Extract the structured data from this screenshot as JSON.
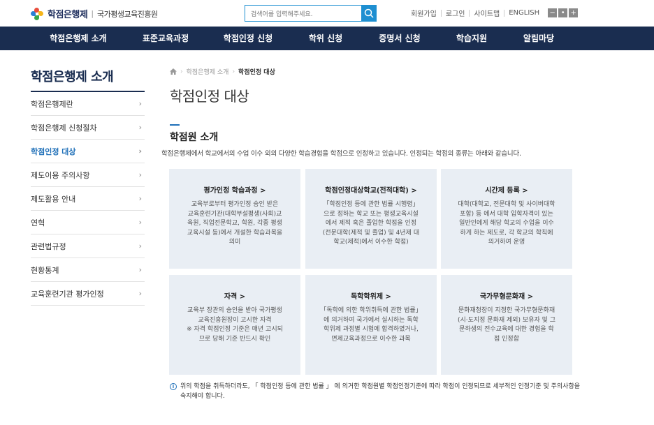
{
  "header": {
    "logo_main": "학점은행제",
    "logo_separator": "|",
    "logo_sub": "국가평생교육진흥원",
    "search_placeholder": "검색어를 입력해주세요.",
    "utils": [
      "회원가입",
      "로그인",
      "사이트맵",
      "ENGLISH"
    ],
    "zoom": [
      "−",
      "•",
      "+"
    ]
  },
  "gnb": [
    "학점은행제 소개",
    "표준교육과정",
    "학점인정 신청",
    "학위 신청",
    "증명서 신청",
    "학습지원",
    "알림마당"
  ],
  "sidebar": {
    "title": "학점은행제 소개",
    "items": [
      {
        "label": "학점은행제란",
        "active": false
      },
      {
        "label": "학점은행제 신청절차",
        "active": false
      },
      {
        "label": "학점인정 대상",
        "active": true
      },
      {
        "label": "제도이용 주의사항",
        "active": false
      },
      {
        "label": "제도활용 안내",
        "active": false
      },
      {
        "label": "연혁",
        "active": false
      },
      {
        "label": "관련법규정",
        "active": false
      },
      {
        "label": "현황통계",
        "active": false
      },
      {
        "label": "교육훈련기관 평가인정",
        "active": false
      }
    ]
  },
  "breadcrumb": [
    "학점은행제 소개",
    "학점인정 대상"
  ],
  "page_title": "학점인정 대상",
  "section": {
    "title": "학점원 소개",
    "desc": "학점은행제에서 학교에서의 수업 이수 외의 다양한 학습경험을 학점으로 인정하고 있습니다. 인정되는 학점의 종류는 아래와 같습니다."
  },
  "cards": [
    {
      "title": "평가인정 학습과정 >",
      "desc": "교육부로부터 평가인정 승인 받은\n교육훈련기관(대학부설평생(사회)교\n육원, 직업전문학교, 학원, 각종 평생\n교육시설 등)에서 개설한 학습과목을\n의미"
    },
    {
      "title": "학점인정대상학교(전적대학) >",
      "desc": "「학점인정 등에 관한 법률 시행령」\n으로 정하는 학교 또는 평생교육시설\n에서 제적 혹은 졸업한 학점을 인정\n(전문대학(제적 및 졸업) 및 4년제 대\n학교(제적)에서 이수한 학점)"
    },
    {
      "title": "시간제 등록 >",
      "desc": "대학(대학교, 전문대학 및 사이버대학\n포함) 등 에서 대학 입학자격이 있는\n일반인에게 해당 학교의 수업을 이수\n하게 하는 제도로, 각 학교의 학칙에\n의거하여 운영"
    },
    {
      "title": "자격 >",
      "desc": "교육부 장관의 승인을 받아 국가평생\n교육진흥원장이 고시한 자격\n※ 자격 학점인정 기준은 매년 고시되\n므로 당해 기준 반드시 확인"
    },
    {
      "title": "독학학위제 >",
      "desc": "「독학에 의한 학위취득에 관한 법률」\n에 의거하여 국가에서 실시하는 독학\n학위제 과정별 시험에 합격하였거나,\n면제교육과정으로 이수한 과목"
    },
    {
      "title": "국가무형문화재 >",
      "desc": "문화재청장이 지정한 국가무형문화재\n(시·도지정 문화재 제외) 보유자 및 그\n문하생의 전수교육에 대한 경험을 학\n점 인정함"
    }
  ],
  "notice": "위의 학점을 취득하더라도, 「 학점인정 등에 관한 법률 」 에 의거한 학점원별 학점인정기준에 따라 학점이 인정되므로 세부적인 인정기준 및 주의사항을 숙지해야 합니다.",
  "colors": {
    "navy": "#1a2d50",
    "accent": "#1e6fb8",
    "search": "#1e8fd1",
    "card_bg": "#e9eef4"
  }
}
